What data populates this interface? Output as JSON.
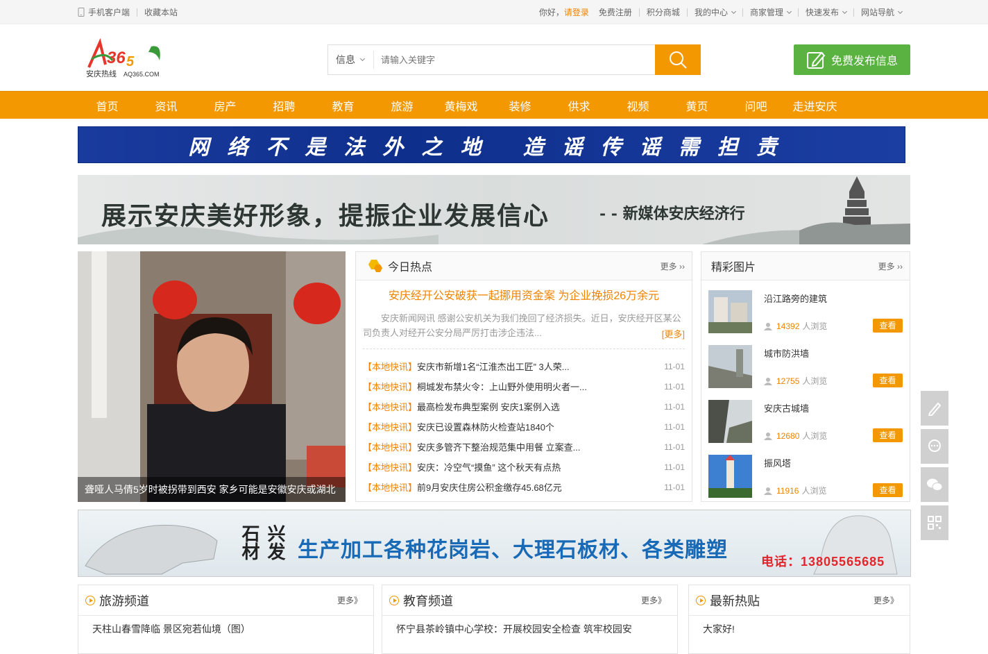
{
  "topbar": {
    "mobile_client": "手机客户端",
    "bookmark": "收藏本站",
    "greeting": "你好，",
    "login": "请登录",
    "register": "免费注册",
    "points_mall": "积分商城",
    "my_center": "我的中心",
    "merchant": "商家管理",
    "quick_publish": "快速发布",
    "site_nav": "网站导航"
  },
  "header": {
    "logo_text_main": "AQ365",
    "logo_sub": "安庆热线",
    "logo_domain": "AQ365.COM",
    "search_type": "信息",
    "search_placeholder": "请输入关键字",
    "publish_label": "免费发布信息"
  },
  "nav": [
    "首页",
    "资讯",
    "房产",
    "招聘",
    "教育",
    "旅游",
    "黄梅戏",
    "装修",
    "供求",
    "视频",
    "黄页",
    "问吧",
    "走进安庆"
  ],
  "banners": {
    "slogan": "网络不是法外之地 造谣传谣需担责",
    "promo_main": "展示安庆美好形象，提振企业发展信心",
    "promo_sub": "- - 新媒体安庆经济行",
    "stone_brand": "兴发石材",
    "stone_text": "生产加工各种花岗岩、大理石板材、各类雕塑",
    "stone_tel": "电话：13805565685"
  },
  "focus": {
    "caption": "聋哑人马倩5岁时被拐带到西安 家乡可能是安徽安庆或湖北"
  },
  "hot": {
    "title": "今日热点",
    "more": "更多 ››",
    "headline": "安庆经开公安破获一起挪用资金案 为企业挽损26万余元",
    "summary": "安庆新闻网讯 感谢公安机关为我们挽回了经济损失。近日，安庆经开区某公司负责人对经开公安分局严厉打击涉企违法...",
    "summary_more": "[更多]",
    "items": [
      {
        "tag": "【本地快讯】",
        "text": "安庆市新增1名“江淮杰出工匠” 3人荣...",
        "date": "11-01"
      },
      {
        "tag": "【本地快讯】",
        "text": "桐城发布禁火令：上山野外使用明火者一...",
        "date": "11-01"
      },
      {
        "tag": "【本地快讯】",
        "text": "最高检发布典型案例 安庆1案例入选",
        "date": "11-01"
      },
      {
        "tag": "【本地快讯】",
        "text": "安庆已设置森林防火检查站1840个",
        "date": "11-01"
      },
      {
        "tag": "【本地快讯】",
        "text": "安庆多管齐下整治规范集中用餐 立案查...",
        "date": "11-01"
      },
      {
        "tag": "【本地快讯】",
        "text": "安庆：冷空气“摸鱼” 这个秋天有点热",
        "date": "11-01"
      },
      {
        "tag": "【本地快讯】",
        "text": "前9月安庆住房公积金缴存45.68亿元",
        "date": "11-01"
      }
    ]
  },
  "pics": {
    "title": "精彩图片",
    "more": "更多 ››",
    "view_label": "人浏览",
    "look_label": "查看",
    "items": [
      {
        "name": "沿江路旁的建筑",
        "views": "14392"
      },
      {
        "name": "城市防洪墙",
        "views": "12755"
      },
      {
        "name": "安庆古城墙",
        "views": "12680"
      },
      {
        "name": "振风塔",
        "views": "11916"
      }
    ]
  },
  "channels": [
    {
      "title": "旅游频道",
      "more": "更多》",
      "first": "天柱山春雪降临 景区宛若仙境（图）"
    },
    {
      "title": "教育频道",
      "more": "更多》",
      "first": "怀宁县茶岭镇中心学校：开展校园安全检查 筑牢校园安"
    },
    {
      "title": "最新热贴",
      "more": "更多》",
      "first": "大家好!"
    }
  ],
  "colors": {
    "accent": "#f39800",
    "publish_green": "#5ab341",
    "slogan_blue": "#1a3b9e"
  }
}
